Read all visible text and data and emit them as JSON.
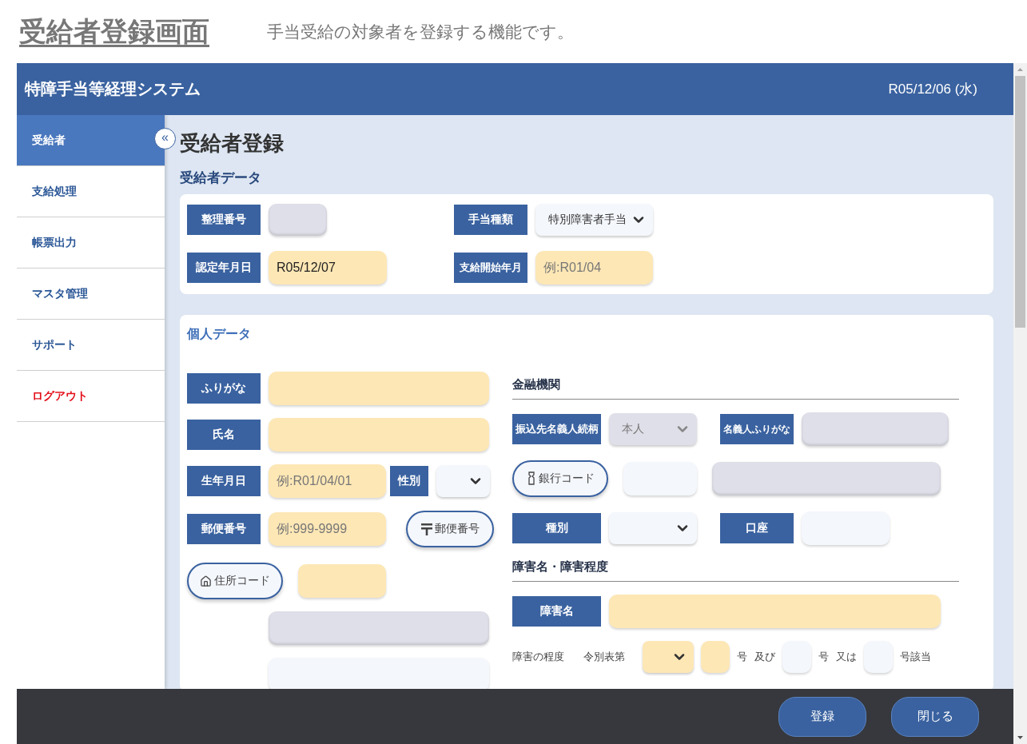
{
  "page": {
    "title": "受給者登録画面",
    "description": "手当受給の対象者を登録する機能です。"
  },
  "app": {
    "title": "特障手当等経理システム",
    "date": "R05/12/06 (水)"
  },
  "sidebar": {
    "collapse_button": "«",
    "items": [
      {
        "label": "受給者",
        "selected": true,
        "kind": "normal"
      },
      {
        "label": "支給処理",
        "selected": false,
        "kind": "normal"
      },
      {
        "label": "帳票出力",
        "selected": false,
        "kind": "normal"
      },
      {
        "label": "マスタ管理",
        "selected": false,
        "kind": "normal"
      },
      {
        "label": "サポート",
        "selected": false,
        "kind": "normal"
      },
      {
        "label": "ログアウト",
        "selected": false,
        "kind": "danger"
      }
    ]
  },
  "heading": "受給者登録",
  "recipient_data": {
    "title": "受給者データ",
    "number": {
      "label": "整理番号",
      "required": false,
      "readonly": true
    },
    "allowance_type": {
      "label": "手当種類",
      "required": false,
      "readonly": false,
      "value": "特別障害者手当"
    },
    "certified_date": {
      "label": "認定年月日",
      "required": true,
      "readonly": false,
      "value": "R05/12/07"
    },
    "start_month": {
      "label": "支給開始年月",
      "required": true,
      "readonly": false,
      "placeholder": "例:R01/04"
    }
  },
  "personal_data": {
    "title": "個人データ",
    "furigana": {
      "label": "ふりがな",
      "required": true,
      "readonly": false
    },
    "name": {
      "label": "氏名",
      "required": true,
      "readonly": false
    },
    "birth_date": {
      "label": "生年月日",
      "required": true,
      "readonly": false,
      "placeholder": "例:R01/04/01"
    },
    "gender": {
      "label": "性別",
      "required": false,
      "readonly": false
    },
    "postal_code": {
      "label": "郵便番号",
      "required": true,
      "readonly": false,
      "placeholder": "例:999-9999"
    },
    "postal_button": {
      "label": "郵便番号"
    },
    "address_button": {
      "label": "住所コード"
    },
    "address_code": {
      "required": true,
      "readonly": false
    },
    "address_1": {
      "required": false,
      "readonly": true
    },
    "address_2": {
      "required": false,
      "readonly": false
    }
  },
  "bank": {
    "title": "金融機関",
    "relation": {
      "label": "振込先名義人続柄",
      "required": false,
      "readonly": true,
      "value": "本人"
    },
    "holder_kana": {
      "label": "名義人ふりがな",
      "required": false,
      "readonly": true
    },
    "bank_button": {
      "label": "銀行コード"
    },
    "bank_code": {
      "required": false,
      "readonly": false
    },
    "bank_name": {
      "required": false,
      "readonly": true
    },
    "account_type": {
      "label": "種別",
      "required": false,
      "readonly": false
    },
    "account": {
      "label": "口座",
      "required": false,
      "readonly": false
    }
  },
  "disability": {
    "title": "障害名・障害程度",
    "name": {
      "label": "障害名",
      "required": true,
      "readonly": false
    },
    "degree_label": "障害の程度",
    "table_label": "令別表第",
    "table_select": {
      "required": true,
      "readonly": false
    },
    "item_1": {
      "required": true,
      "readonly": false
    },
    "unit_1": "号",
    "and": "及び",
    "item_2": {
      "required": false,
      "readonly": false
    },
    "unit_2": "号",
    "or": "又は",
    "item_3": {
      "required": false,
      "readonly": false
    },
    "unit_3": "号該当"
  },
  "footer": {
    "buttons": [
      "登録",
      "閉じる"
    ]
  }
}
